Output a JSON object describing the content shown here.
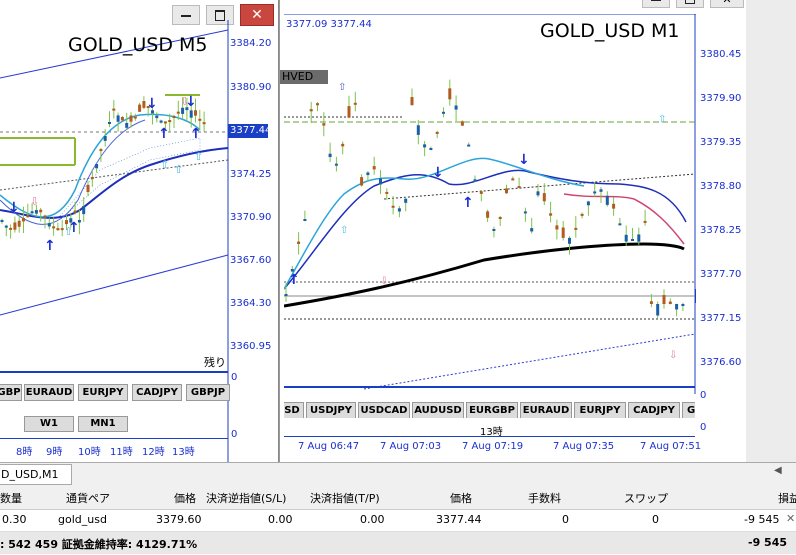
{
  "left_chart": {
    "title": "GOLD_USD M5",
    "price_labels": [
      "3384.20",
      "3380.90",
      "3377.44",
      "3374.25",
      "3370.90",
      "3367.60",
      "3364.30",
      "3360.95"
    ],
    "current_price": "3377.44",
    "remaining_label": "残り",
    "symbol_tabs": [
      "GBP",
      "EURAUD",
      "EURJPY",
      "CADJPY",
      "GBPJP"
    ],
    "period_tabs": [
      "W1",
      "MN1"
    ],
    "time_labels": [
      "8時",
      "9時",
      "10時",
      "11時",
      "12時",
      "13時"
    ],
    "ind_zero": "0",
    "ind_zero2": "0"
  },
  "right_chart": {
    "title": "GOLD_USD M1",
    "ohlc_text": "3377.09 3377.44",
    "price_labels": [
      "3380.45",
      "3379.90",
      "3379.35",
      "3378.80",
      "3378.25",
      "3377.70",
      "3377.15",
      "3376.60"
    ],
    "current_price": "3377.44",
    "badge": "HVED",
    "symbol_tabs": [
      "SD",
      "USDJPY",
      "USDCAD",
      "AUDUSD",
      "EURGBP",
      "EURAUD",
      "EURJPY",
      "CADJPY",
      "GI"
    ],
    "hour_label": "13時",
    "time_labels": [
      "7 Aug 06:47",
      "7 Aug 07:03",
      "7 Aug 07:19",
      "7 Aug 07:35",
      "7 Aug 07:51"
    ],
    "ind_zero": "0",
    "ind_zero2": "0"
  },
  "tab_bar": {
    "tab_label": "D_USD,M1"
  },
  "positions": {
    "headers": [
      "数量",
      "通貨ペア",
      "価格",
      "決済逆指値(S/L)",
      "決済指値(T/P)",
      "価格",
      "手数料",
      "スワップ",
      "損益"
    ],
    "row": [
      "0.30",
      "gold_usd",
      "3379.60",
      "0.00",
      "0.00",
      "3377.44",
      "0",
      "0",
      "-9 545"
    ],
    "summary": ": 542 459  証拠金維持率: 4129.71%",
    "total": "-9 545"
  },
  "colors": {
    "up_candle": "#1a5fa8",
    "down_candle": "#b35a1f",
    "accent_blue": "#0000cc",
    "ma_black": "#000000"
  }
}
